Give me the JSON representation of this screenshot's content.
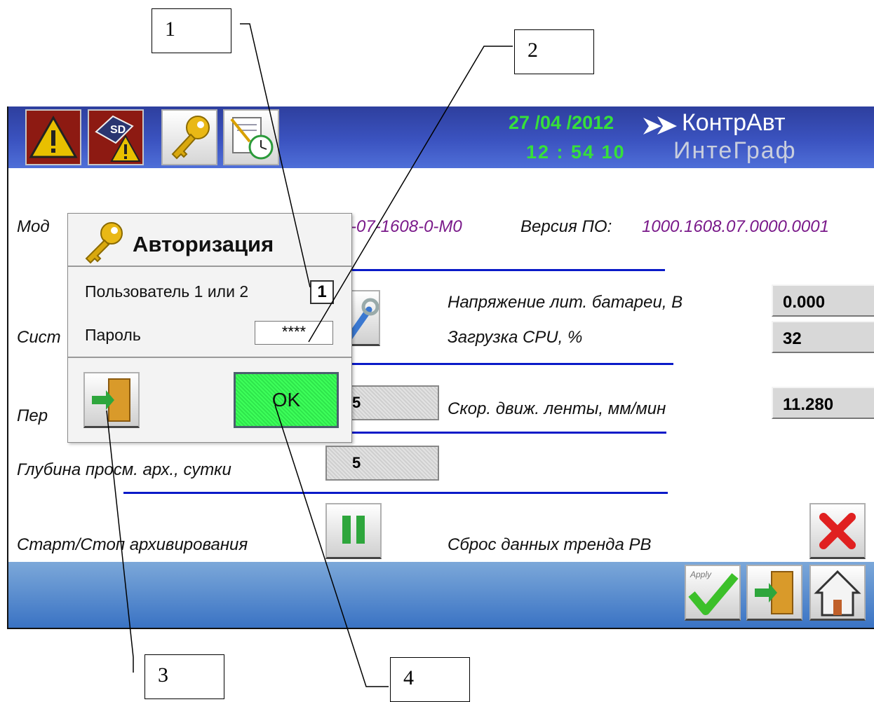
{
  "callouts": [
    "1",
    "2",
    "3",
    "4"
  ],
  "header": {
    "date": "27 /04 /2012",
    "time": "12 : 54   10",
    "brand_line1": "КонтрАвт",
    "brand_line2": "ИнтеГраф",
    "buttons": [
      "warning-icon",
      "sd-card-warning-icon",
      "key-icon",
      "schedule-clock-icon"
    ]
  },
  "main": {
    "model_label_visible": "Мод",
    "model_value_visible": "-07-1608-0-М0",
    "version_label": "Версия ПО:",
    "version_value": "1000.1608.07.0000.0001",
    "system_label_visible": "Сист",
    "battery_label": "Напряжение лит. батареи, В",
    "battery_value": "0.000",
    "cpu_label": "Загрузка CPU, %",
    "cpu_value": "32",
    "period_label_visible": "Пер",
    "period_value": "5",
    "tape_speed_label": "Скор. движ. ленты, мм/мин",
    "tape_speed_value": "11.280",
    "archive_depth_label": "Глубина просм. арх., сутки",
    "archive_depth_value": "5",
    "archiving_label": "Старт/Стоп архивирования",
    "reset_trend_label": "Сброс данных тренда РВ"
  },
  "footer": {
    "apply_label": "Apply"
  },
  "dialog": {
    "title": "Авторизация",
    "user_label": "Пользователь 1 или 2",
    "user_value": "1",
    "password_label": "Пароль",
    "password_value": "****",
    "ok_label": "OK"
  },
  "colors": {
    "header_blue": "#3b53c0",
    "clock_green": "#36e03a",
    "separator_blue": "#0a1ac8",
    "ok_green": "#3dff5a",
    "value_purple": "#7a1a8a"
  }
}
